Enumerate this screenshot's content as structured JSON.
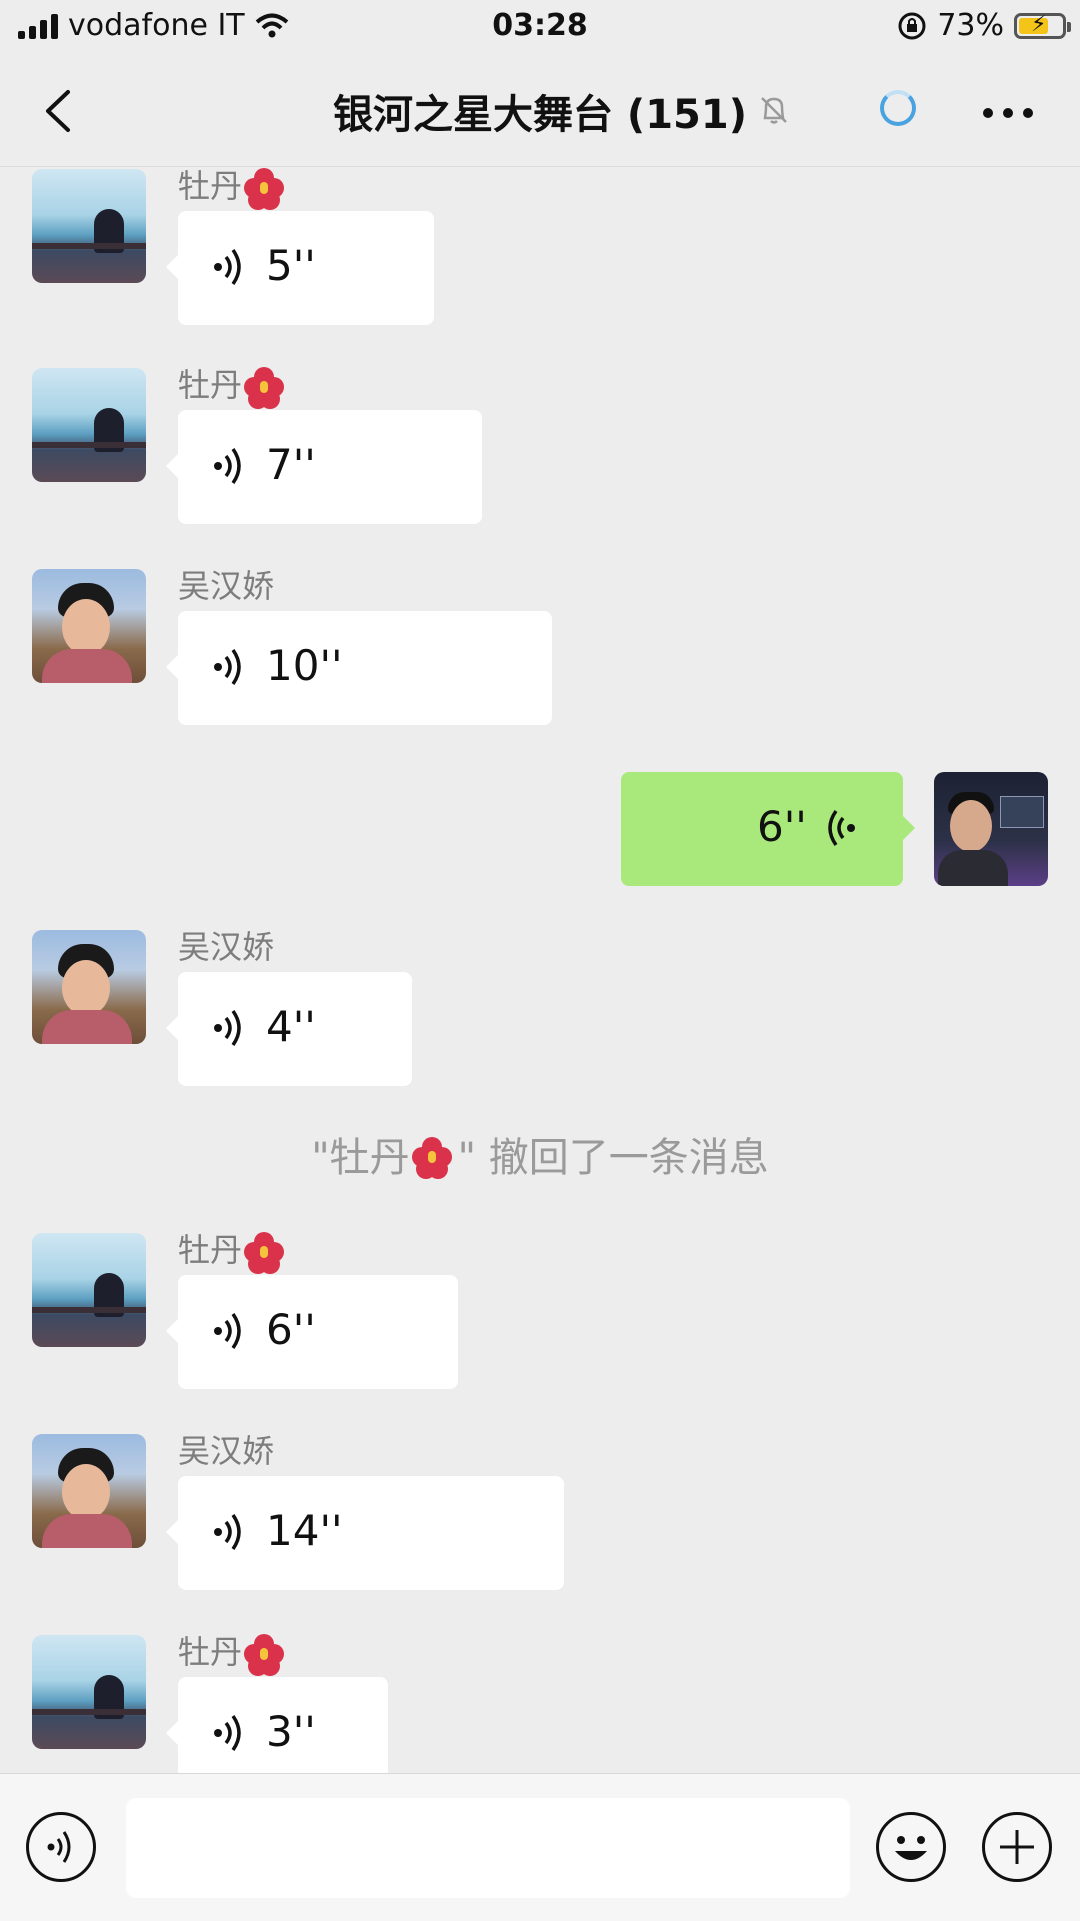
{
  "status_bar": {
    "carrier": "vodafone IT",
    "time": "03:28",
    "battery": "73%"
  },
  "nav": {
    "title": "银河之星大舞台 (151)"
  },
  "messages": [
    {
      "sender": "牡丹",
      "duration": "5''"
    },
    {
      "sender": "牡丹",
      "duration": "7''"
    },
    {
      "sender": "吴汉娇",
      "duration": "10''"
    },
    {
      "sender": "",
      "duration": "6''"
    },
    {
      "sender": "吴汉娇",
      "duration": "4''"
    },
    {
      "sender": "牡丹",
      "duration": "6''"
    },
    {
      "sender": "吴汉娇",
      "duration": "14''"
    },
    {
      "sender": "牡丹",
      "duration": "3''"
    }
  ],
  "system": {
    "recall_name": "\"牡丹",
    "recall_text": "\" 撤回了一条消息"
  },
  "colors": {
    "background": "#ededed",
    "self_bubble": "#a9e87a",
    "other_bubble": "#ffffff",
    "battery": "#f4c518"
  }
}
